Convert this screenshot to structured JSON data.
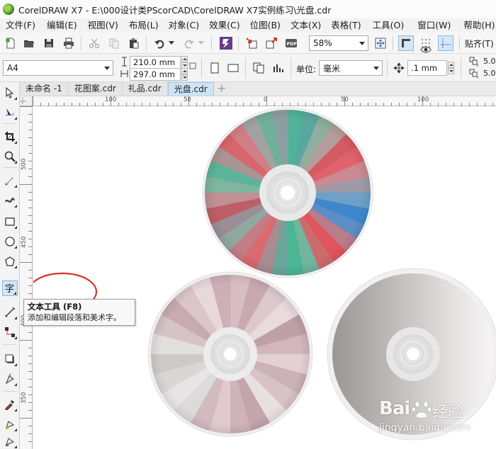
{
  "window": {
    "title": "CorelDRAW X7 - E:\\000设计类PScorCAD\\CorelDRAW  X7实例练习\\光盘.cdr"
  },
  "menu": [
    "文件(F)",
    "编辑(E)",
    "视图(V)",
    "布局(L)",
    "对象(C)",
    "效果(C)",
    "位图(B)",
    "文本(X)",
    "表格(T)",
    "工具(O)",
    "窗口(W)",
    "帮助(H)"
  ],
  "toolbar": {
    "zoom_value": "58%",
    "snap_label": "贴齐(T)"
  },
  "property_bar": {
    "page_size": "A4",
    "width": "210.0 mm",
    "height": "297.0 mm",
    "units_label": "单位:",
    "units_value": "毫米",
    "nudge_value": ".1 mm",
    "dup_x": "5.0",
    "dup_y": "5.0"
  },
  "doc_tabs": [
    "未命名 -1",
    "花图案.cdr",
    "礼品.cdr",
    "光盘.cdr"
  ],
  "active_tab_index": 3,
  "rulers": {
    "h_labels": [
      "100",
      "50",
      "0",
      "50",
      "100"
    ],
    "v_labels": [
      "500",
      "450",
      "400",
      "350"
    ]
  },
  "tooltip": {
    "title": "文本工具 (F8)",
    "description": "添加和编辑段落和美术字。"
  },
  "watermark": {
    "brand": "Bai",
    "brand_suffix": "经验",
    "url": "jingyan.baidu.com"
  },
  "colors": {
    "annotation_circle": "#d8322e",
    "active_tab": "#cde4f7",
    "accent_blue": "#3d86c9"
  }
}
